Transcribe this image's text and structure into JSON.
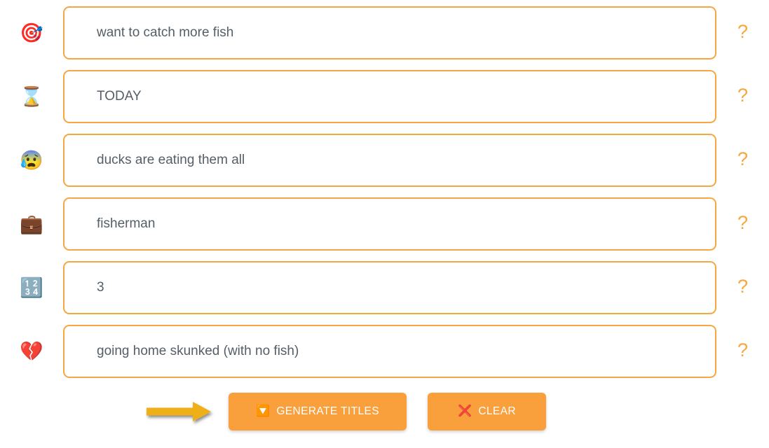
{
  "theme": {
    "page_background": "#ffffff",
    "accent_orange": "#f6a73f",
    "button_orange": "#f9a03c",
    "field_text": "#555e66",
    "arrow_gold": "#efaf13",
    "clear_x_red": "#e8315f",
    "generate_arrow_blue": "#1eabf0"
  },
  "form": {
    "rows": [
      {
        "icon": "🎯",
        "icon_name": "target-dart-icon",
        "value": "want to catch more fish",
        "placeholder": "want to catch more fish",
        "help": "?"
      },
      {
        "icon": "⌛",
        "icon_name": "hourglass-icon",
        "value": "TODAY",
        "placeholder": "TODAY",
        "help": "?"
      },
      {
        "icon": "😰",
        "icon_name": "anxious-face-with-sweat-icon",
        "value": "ducks are eating them all",
        "placeholder": "ducks are eating them all",
        "help": "?"
      },
      {
        "icon": "💼",
        "icon_name": "briefcase-icon",
        "value": "fisherman",
        "placeholder": "fisherman",
        "help": "?"
      },
      {
        "icon": "🔢",
        "icon_name": "input-numbers-icon",
        "value": "3",
        "placeholder": "3",
        "help": "?"
      },
      {
        "icon": "💔",
        "icon_name": "broken-heart-icon",
        "value": "going home skunked (with no fish)",
        "placeholder": "going home skunked (with no fish)",
        "help": "?"
      }
    ]
  },
  "actions": {
    "generate": {
      "label": "GENERATE TITLES",
      "emoji": "🔽"
    },
    "clear": {
      "label": "CLEAR",
      "emoji": "❌"
    }
  },
  "annotation": {
    "arrow_name": "pointer-arrow-to-generate-button"
  }
}
